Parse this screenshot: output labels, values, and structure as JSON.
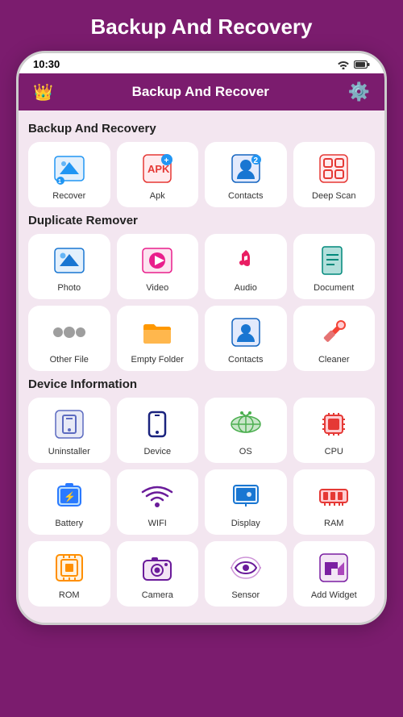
{
  "page": {
    "title": "Backup And Recovery",
    "status_time": "10:30",
    "header_title": "Backup And Recover"
  },
  "sections": [
    {
      "id": "backup",
      "title": "Backup And Recovery",
      "items": [
        {
          "id": "recover",
          "label": "Recover",
          "icon": "recover"
        },
        {
          "id": "apk",
          "label": "Apk",
          "icon": "apk"
        },
        {
          "id": "contacts-b",
          "label": "Contacts",
          "icon": "contacts-b"
        },
        {
          "id": "deepscan",
          "label": "Deep Scan",
          "icon": "deepscan"
        }
      ]
    },
    {
      "id": "duplicate",
      "title": "Duplicate Remover",
      "items": [
        {
          "id": "photo",
          "label": "Photo",
          "icon": "photo"
        },
        {
          "id": "video",
          "label": "Video",
          "icon": "video"
        },
        {
          "id": "audio",
          "label": "Audio",
          "icon": "audio"
        },
        {
          "id": "document",
          "label": "Document",
          "icon": "document"
        },
        {
          "id": "otherfile",
          "label": "Other File",
          "icon": "otherfile"
        },
        {
          "id": "emptyfolder",
          "label": "Empty Folder",
          "icon": "emptyfolder"
        },
        {
          "id": "contacts-d",
          "label": "Contacts",
          "icon": "contacts-d"
        },
        {
          "id": "cleaner",
          "label": "Cleaner",
          "icon": "cleaner"
        }
      ]
    },
    {
      "id": "device",
      "title": "Device Information",
      "items": [
        {
          "id": "uninstaller",
          "label": "Uninstaller",
          "icon": "uninstaller"
        },
        {
          "id": "device",
          "label": "Device",
          "icon": "device"
        },
        {
          "id": "os",
          "label": "OS",
          "icon": "os"
        },
        {
          "id": "cpu",
          "label": "CPU",
          "icon": "cpu"
        },
        {
          "id": "battery",
          "label": "Battery",
          "icon": "battery"
        },
        {
          "id": "wifi",
          "label": "WIFI",
          "icon": "wifi"
        },
        {
          "id": "display",
          "label": "Display",
          "icon": "display"
        },
        {
          "id": "ram",
          "label": "RAM",
          "icon": "ram"
        },
        {
          "id": "rom",
          "label": "ROM",
          "icon": "rom"
        },
        {
          "id": "camera",
          "label": "Camera",
          "icon": "camera"
        },
        {
          "id": "sensor",
          "label": "Sensor",
          "icon": "sensor"
        },
        {
          "id": "addwidget",
          "label": "Add Widget",
          "icon": "addwidget"
        }
      ]
    }
  ]
}
